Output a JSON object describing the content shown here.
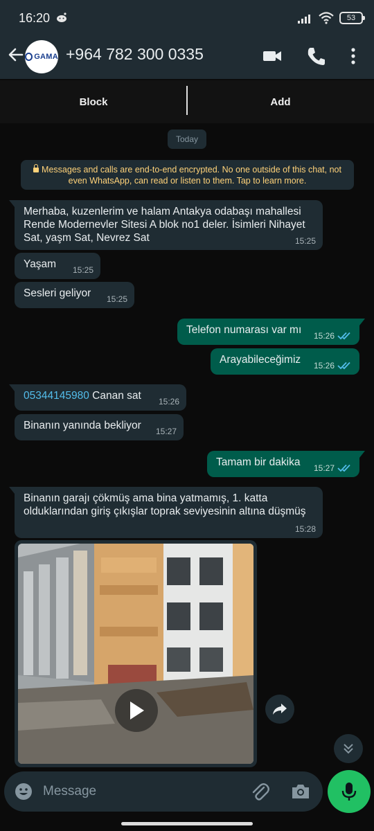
{
  "status": {
    "time": "16:20",
    "battery": "53"
  },
  "header": {
    "avatar_text": "GAMA",
    "contact_name": "+964 782 300 0335"
  },
  "actions": {
    "block": "Block",
    "add": "Add"
  },
  "date_label": "Today",
  "encryption_notice": "Messages and calls are end-to-end encrypted. No one outside of this chat, not even WhatsApp, can read or listen to them. Tap to learn more.",
  "messages": [
    {
      "dir": "in",
      "text": "Merhaba, kuzenlerim ve halam Antakya odabaşı mahallesi Rende Modernevler Sitesi A blok no1 deler. İsimleri Nihayet Sat, yaşm Sat, Nevrez Sat",
      "time": "15:25"
    },
    {
      "dir": "in",
      "text": "Yaşam",
      "time": "15:25"
    },
    {
      "dir": "in",
      "text": "Sesleri geliyor",
      "time": "15:25"
    },
    {
      "dir": "out",
      "text": "Telefon numarası var mı",
      "time": "15:26"
    },
    {
      "dir": "out",
      "text": "Arayabileceğimiz",
      "time": "15:26"
    },
    {
      "dir": "in",
      "link": "05344145980",
      "text": " Canan sat",
      "time": "15:26"
    },
    {
      "dir": "in",
      "text": "Binanın yanında bekliyor",
      "time": "15:27"
    },
    {
      "dir": "out",
      "text": "Tamam bir dakika",
      "time": "15:27"
    },
    {
      "dir": "in",
      "text": "Binanın garajı çökmüş ama bina yatmamış, 1. katta olduklarından giriş çıkışlar toprak seviyesinin altına düşmüş",
      "time": "15:28"
    }
  ],
  "composer": {
    "placeholder": "Message"
  },
  "colors": {
    "incoming": "#1f2c33",
    "outgoing": "#005c4b",
    "accent": "#21c063",
    "link": "#53bdeb",
    "ticks": "#53bdeb"
  },
  "icons": [
    "back-arrow-icon",
    "video-call-icon",
    "phone-icon",
    "more-vert-icon",
    "lock-icon",
    "read-receipt-icon",
    "play-icon",
    "forward-icon",
    "scroll-down-icon",
    "emoji-icon",
    "attach-icon",
    "camera-icon",
    "mic-icon"
  ]
}
